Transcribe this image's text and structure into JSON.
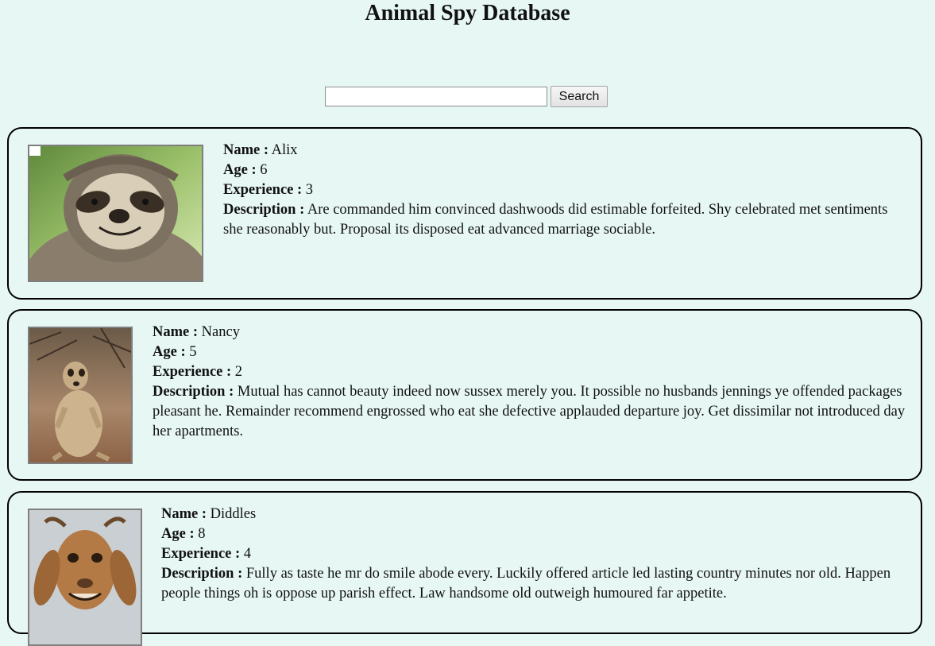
{
  "page": {
    "title": "Animal Spy Database"
  },
  "search": {
    "value": "",
    "placeholder": "",
    "button_label": "Search"
  },
  "labels": {
    "name": "Name :",
    "age": "Age :",
    "experience": "Experience :",
    "description": "Description :"
  },
  "animals": [
    {
      "name": "Alix",
      "age": "6",
      "experience": "3",
      "description": "Are commanded him convinced dashwoods did estimable forfeited. Shy celebrated met sentiments she reasonably but. Proposal its disposed eat advanced marriage sociable.",
      "photo_icon": "sloth-photo"
    },
    {
      "name": "Nancy",
      "age": "5",
      "experience": "2",
      "description": "Mutual has cannot beauty indeed now sussex merely you. It possible no husbands jennings ye offended packages pleasant he. Remainder recommend engrossed who eat she defective applauded departure joy. Get dissimilar not introduced day her apartments.",
      "photo_icon": "meerkat-photo"
    },
    {
      "name": "Diddles",
      "age": "8",
      "experience": "4",
      "description": "Fully as taste he mr do smile abode every. Luckily offered article led lasting country minutes nor old. Happen people things oh is oppose up parish effect. Law handsome old outweigh humoured far appetite.",
      "photo_icon": "goat-photo"
    }
  ],
  "colors": {
    "background": "#e6f7f4",
    "card_border": "#000000"
  }
}
